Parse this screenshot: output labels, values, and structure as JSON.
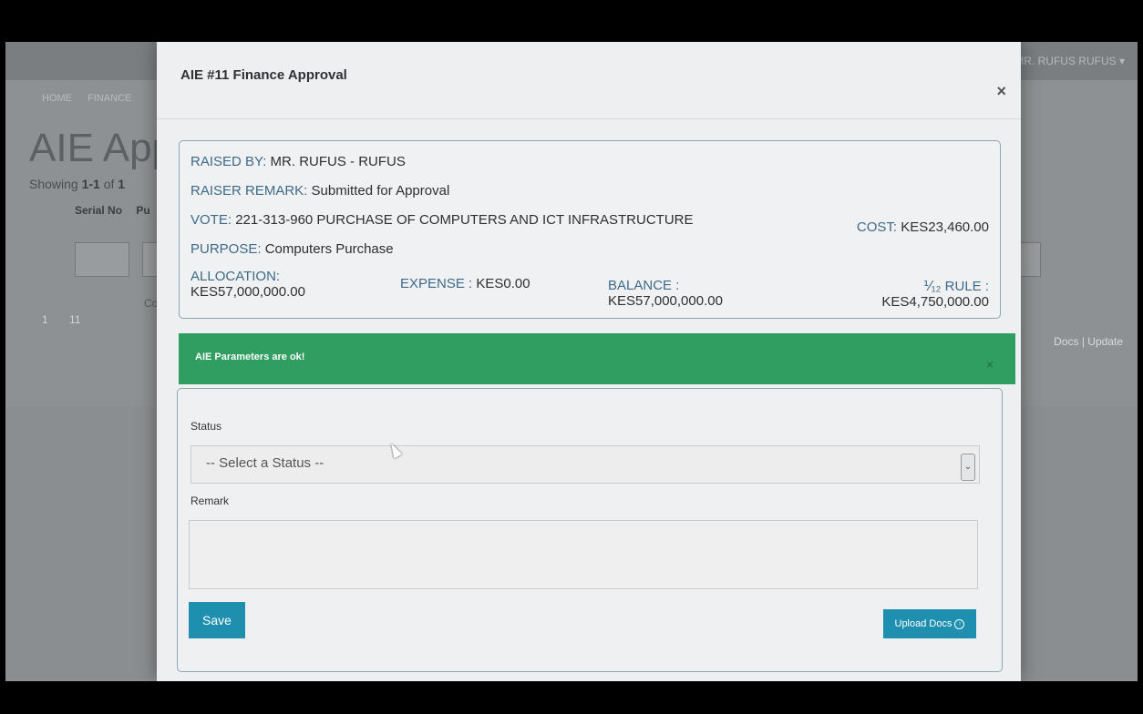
{
  "background": {
    "user_menu": "MR. RUFUS RUFUS ▾",
    "breadcrumb": [
      "HOME",
      "FINANCE"
    ],
    "page_title": "AIE App",
    "showing_prefix": "Showing",
    "showing_range": "1-1",
    "showing_of": "of",
    "showing_total": "1",
    "columns": [
      "Serial No",
      "Pu"
    ],
    "row": [
      "1",
      "11"
    ],
    "row_extra": "Co",
    "actions": "Docs | Update"
  },
  "modal": {
    "title": "AIE #11 Finance Approval",
    "close_icon": "×",
    "info": {
      "raised_by_label": "RAISED BY:",
      "raised_by": "MR. RUFUS - RUFUS",
      "raiser_remark_label": "RAISER REMARK:",
      "raiser_remark": "Submitted for Approval",
      "vote_label": "VOTE:",
      "vote": "221-313-960 PURCHASE OF COMPUTERS AND ICT INFRASTRUCTURE",
      "cost_label": "COST:",
      "cost": "KES23,460.00",
      "purpose_label": "PURPOSE:",
      "purpose": "Computers Purchase",
      "allocation_label": "ALLOCATION:",
      "allocation": "KES57,000,000.00",
      "expense_label": "EXPENSE :",
      "expense": "KES0.00",
      "balance_label": "BALANCE :",
      "balance": "KES57,000,000.00",
      "rule_label": "⅟₁₂ RULE :",
      "rule": "KES4,750,000.00"
    },
    "alert": {
      "text": "AIE Parameters are ok!",
      "close": "×"
    },
    "form": {
      "status_label": "Status",
      "status_selected": "-- Select a Status --",
      "remark_label": "Remark",
      "remark_value": "",
      "save_label": "Save",
      "upload_label": "Upload Docs"
    }
  },
  "colors": {
    "alert_green": "#2f9e60",
    "button_blue": "#1f8fb0",
    "label_blue": "#3d6a88"
  }
}
